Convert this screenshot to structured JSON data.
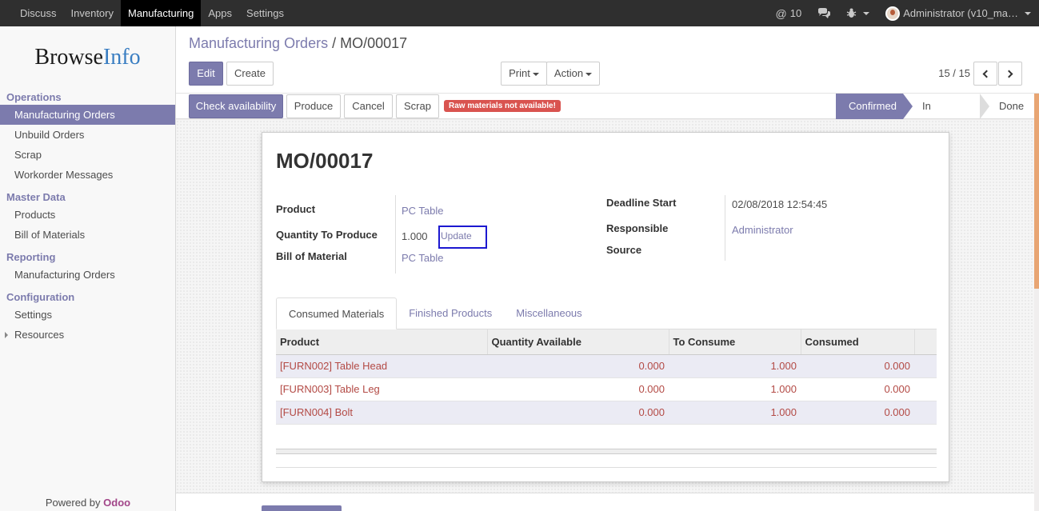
{
  "topbar": {
    "menus": [
      "Discuss",
      "Inventory",
      "Manufacturing",
      "Apps",
      "Settings"
    ],
    "active_menu": "Manufacturing",
    "notification_count": "10",
    "user": "Administrator (v10_ma…"
  },
  "sidebar": {
    "logo_browse": "Browse",
    "logo_info": "Info",
    "sections": [
      {
        "title": "Operations",
        "items": [
          "Manufacturing Orders",
          "Unbuild Orders",
          "Scrap",
          "Workorder Messages"
        ]
      },
      {
        "title": "Master Data",
        "items": [
          "Products",
          "Bill of Materials"
        ]
      },
      {
        "title": "Reporting",
        "items": [
          "Manufacturing Orders"
        ]
      },
      {
        "title": "Configuration",
        "items": [
          "Settings",
          "Resources"
        ]
      }
    ],
    "powered_prefix": "Powered by ",
    "powered_brand": "Odoo"
  },
  "control_panel": {
    "breadcrumb_parent": "Manufacturing Orders",
    "breadcrumb_sep": " / ",
    "breadcrumb_current": "MO/00017",
    "edit": "Edit",
    "create": "Create",
    "print": "Print",
    "action": "Action",
    "pager": "15 / 15"
  },
  "statusbar": {
    "check_availability": "Check availability",
    "produce": "Produce",
    "cancel": "Cancel",
    "scrap": "Scrap",
    "warning": "Raw materials not available!",
    "stages": [
      "Confirmed",
      "In Progress",
      "Done"
    ],
    "current_stage": "Confirmed"
  },
  "form": {
    "title": "MO/00017",
    "product_label": "Product",
    "product_value": "PC Table",
    "qty_label": "Quantity To Produce",
    "qty_value": "1.000",
    "update_link": "Update",
    "bom_label": "Bill of Material",
    "bom_value": "PC Table",
    "deadline_label": "Deadline Start",
    "deadline_value": "02/08/2018 12:54:45",
    "responsible_label": "Responsible",
    "responsible_value": "Administrator",
    "source_label": "Source"
  },
  "tabs": [
    "Consumed Materials",
    "Finished Products",
    "Miscellaneous"
  ],
  "table": {
    "headers": [
      "Product",
      "Quantity Available",
      "To Consume",
      "Consumed"
    ],
    "rows": [
      [
        "[FURN002] Table Head",
        "0.000",
        "1.000",
        "0.000"
      ],
      [
        "[FURN003] Table Leg",
        "0.000",
        "1.000",
        "0.000"
      ],
      [
        "[FURN004] Bolt",
        "0.000",
        "1.000",
        "0.000"
      ]
    ]
  }
}
